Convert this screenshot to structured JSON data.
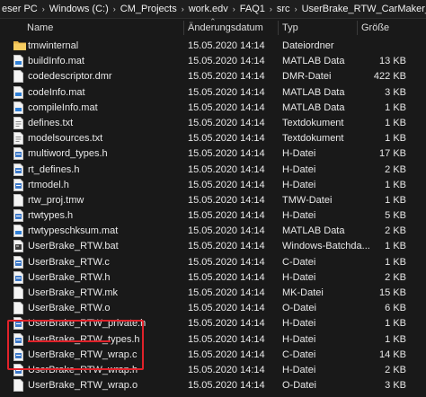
{
  "breadcrumb": [
    "eser PC",
    "Windows (C:)",
    "CM_Projects",
    "work.edv",
    "FAQ1",
    "src",
    "UserBrake_RTW_CarMaker_rtw"
  ],
  "columns": {
    "name": "Name",
    "date": "Änderungsdatum",
    "type": "Typ",
    "size": "Größe"
  },
  "files": [
    {
      "name": "tmwinternal",
      "date": "15.05.2020 14:14",
      "type": "Dateiordner",
      "size": "",
      "icon": "folder-icon"
    },
    {
      "name": "buildInfo.mat",
      "date": "15.05.2020 14:14",
      "type": "MATLAB Data",
      "size": "13 KB",
      "icon": "mat-file-icon"
    },
    {
      "name": "codedescriptor.dmr",
      "date": "15.05.2020 14:14",
      "type": "DMR-Datei",
      "size": "422 KB",
      "icon": "file-icon"
    },
    {
      "name": "codeInfo.mat",
      "date": "15.05.2020 14:14",
      "type": "MATLAB Data",
      "size": "3 KB",
      "icon": "mat-file-icon"
    },
    {
      "name": "compileInfo.mat",
      "date": "15.05.2020 14:14",
      "type": "MATLAB Data",
      "size": "1 KB",
      "icon": "mat-file-icon"
    },
    {
      "name": "defines.txt",
      "date": "15.05.2020 14:14",
      "type": "Textdokument",
      "size": "1 KB",
      "icon": "text-file-icon"
    },
    {
      "name": "modelsources.txt",
      "date": "15.05.2020 14:14",
      "type": "Textdokument",
      "size": "1 KB",
      "icon": "text-file-icon"
    },
    {
      "name": "multiword_types.h",
      "date": "15.05.2020 14:14",
      "type": "H-Datei",
      "size": "17 KB",
      "icon": "code-file-icon"
    },
    {
      "name": "rt_defines.h",
      "date": "15.05.2020 14:14",
      "type": "H-Datei",
      "size": "2 KB",
      "icon": "code-file-icon"
    },
    {
      "name": "rtmodel.h",
      "date": "15.05.2020 14:14",
      "type": "H-Datei",
      "size": "1 KB",
      "icon": "code-file-icon"
    },
    {
      "name": "rtw_proj.tmw",
      "date": "15.05.2020 14:14",
      "type": "TMW-Datei",
      "size": "1 KB",
      "icon": "file-icon"
    },
    {
      "name": "rtwtypes.h",
      "date": "15.05.2020 14:14",
      "type": "H-Datei",
      "size": "5 KB",
      "icon": "code-file-icon"
    },
    {
      "name": "rtwtypeschksum.mat",
      "date": "15.05.2020 14:14",
      "type": "MATLAB Data",
      "size": "2 KB",
      "icon": "mat-file-icon"
    },
    {
      "name": "UserBrake_RTW.bat",
      "date": "15.05.2020 14:14",
      "type": "Windows-Batchda...",
      "size": "1 KB",
      "icon": "batch-file-icon"
    },
    {
      "name": "UserBrake_RTW.c",
      "date": "15.05.2020 14:14",
      "type": "C-Datei",
      "size": "1 KB",
      "icon": "code-file-icon"
    },
    {
      "name": "UserBrake_RTW.h",
      "date": "15.05.2020 14:14",
      "type": "H-Datei",
      "size": "2 KB",
      "icon": "code-file-icon"
    },
    {
      "name": "UserBrake_RTW.mk",
      "date": "15.05.2020 14:14",
      "type": "MK-Datei",
      "size": "15 KB",
      "icon": "file-icon"
    },
    {
      "name": "UserBrake_RTW.o",
      "date": "15.05.2020 14:14",
      "type": "O-Datei",
      "size": "6 KB",
      "icon": "file-icon"
    },
    {
      "name": "UserBrake_RTW_private.h",
      "date": "15.05.2020 14:14",
      "type": "H-Datei",
      "size": "1 KB",
      "icon": "code-file-icon"
    },
    {
      "name": "UserBrake_RTW_types.h",
      "date": "15.05.2020 14:14",
      "type": "H-Datei",
      "size": "1 KB",
      "icon": "code-file-icon"
    },
    {
      "name": "UserBrake_RTW_wrap.c",
      "date": "15.05.2020 14:14",
      "type": "C-Datei",
      "size": "14 KB",
      "icon": "code-file-icon"
    },
    {
      "name": "UserBrake_RTW_wrap.h",
      "date": "15.05.2020 14:14",
      "type": "H-Datei",
      "size": "2 KB",
      "icon": "code-file-icon"
    },
    {
      "name": "UserBrake_RTW_wrap.o",
      "date": "15.05.2020 14:14",
      "type": "O-Datei",
      "size": "3 KB",
      "icon": "file-icon"
    }
  ],
  "colors": {
    "background": "#191919",
    "text": "#e8e8e8",
    "highlight": "#e0222a",
    "folder": "#e8b74a"
  }
}
